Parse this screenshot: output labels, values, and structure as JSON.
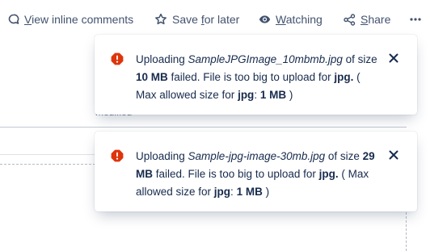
{
  "toolbar": {
    "comments": {
      "prefix": "",
      "underlined": "V",
      "rest": "iew inline comments",
      "icon": "speech-bubble-icon"
    },
    "save": {
      "prefix": "Save ",
      "underlined": "f",
      "rest": "or later",
      "icon": "star-icon"
    },
    "watching": {
      "prefix": "",
      "underlined": "W",
      "rest": "atching",
      "icon": "eye-icon"
    },
    "share": {
      "prefix": "",
      "underlined": "S",
      "rest": "hare",
      "icon": "share-icon"
    },
    "more_icon": "more-icon"
  },
  "background": {
    "partial_text": "modified"
  },
  "flags": [
    {
      "t1": "Uploading ",
      "filename": "SampleJPGImage_10mbmb.jpg",
      "t2": " of size ",
      "size": "10 MB",
      "t3": " failed. File is too big to upload for ",
      "ext": "jpg.",
      "t4": " ( Max allowed size for ",
      "ext2": "jpg",
      "t5": ": ",
      "max": "1 MB",
      "t6": " )"
    },
    {
      "t1": "Uploading ",
      "filename": "Sample-jpg-image-30mb.jpg",
      "t2": " of size ",
      "size": "29 MB",
      "t3": " failed. File is too big to upload for ",
      "ext": "jpg.",
      "t4": " ( Max allowed size for ",
      "ext2": "jpg",
      "t5": ": ",
      "max": "1 MB",
      "t6": " )"
    }
  ],
  "colors": {
    "error": "#de350b",
    "text": "#172b4d",
    "toolbar_text": "#42526e"
  }
}
